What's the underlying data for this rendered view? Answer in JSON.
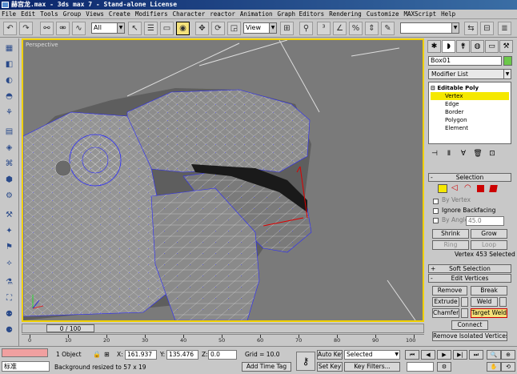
{
  "window": {
    "title": "赫宫龙.max - 3ds max 7 - Stand-alone License"
  },
  "menu": [
    "File",
    "Edit",
    "Tools",
    "Group",
    "Views",
    "Create",
    "Modifiers",
    "Character",
    "reactor",
    "Animation",
    "Graph Editors",
    "Rendering",
    "Customize",
    "MAXScript",
    "Help"
  ],
  "toolbar": {
    "selection_filter": "All",
    "reference_coord": "View"
  },
  "viewport": {
    "label": "Perspective"
  },
  "command_panel": {
    "object_name": "Box01",
    "object_color": "#6cc84a",
    "modifier_list": "Modifier List",
    "stack": {
      "root": "Editable Poly",
      "items": [
        "Vertex",
        "Edge",
        "Border",
        "Polygon",
        "Element"
      ],
      "selected": "Vertex"
    },
    "selection": {
      "title": "Selection",
      "by_vertex": "By Vertex",
      "ignore_backfacing": "Ignore Backfacing",
      "by_angle": "By Angle:",
      "angle_value": "45.0",
      "shrink": "Shrink",
      "grow": "Grow",
      "ring": "Ring",
      "loop": "Loop",
      "status": "Vertex 453 Selected"
    },
    "soft_selection": {
      "title": "Soft Selection"
    },
    "edit_vertices": {
      "title": "Edit Vertices",
      "remove": "Remove",
      "break": "Break",
      "extrude": "Extrude",
      "weld": "Weld",
      "chamfer": "Chamfer",
      "target_weld": "Target Weld",
      "connect": "Connect",
      "remove_isolated": "Remove Isolated Vertices"
    }
  },
  "timeline": {
    "slider": "0 / 100",
    "ticks": [
      "0",
      "10",
      "20",
      "30",
      "40",
      "50",
      "60",
      "70",
      "80",
      "90",
      "100"
    ]
  },
  "status": {
    "objects": "1 Object",
    "x_label": "X:",
    "x": "161.937",
    "y_label": "Y:",
    "y": "135.476",
    "z_label": "Z:",
    "z": "0.0",
    "grid": "Grid = 10.0",
    "auto_key": "Auto Key",
    "key_mode": "Selected",
    "set_key": "Set Key",
    "key_filters": "Key Filters...",
    "add_time_tag": "Add Time Tag",
    "prompt": "Background resized to 57 x 19",
    "ime": "标准"
  }
}
